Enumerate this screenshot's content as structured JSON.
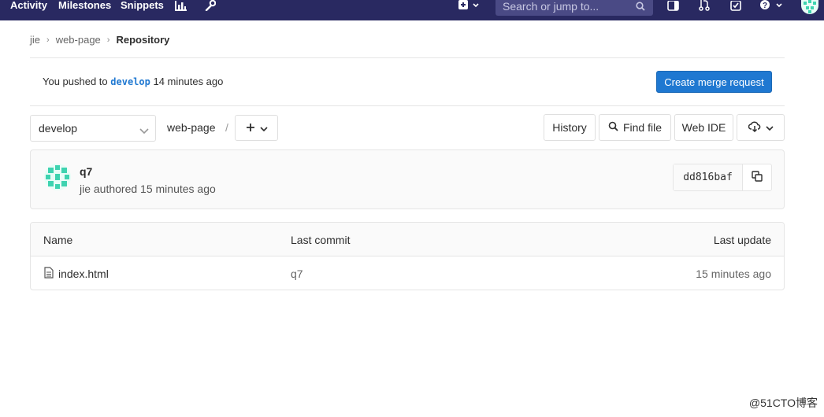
{
  "topbar": {
    "nav": [
      "Activity",
      "Milestones",
      "Snippets"
    ],
    "search_placeholder": "Search or jump to...",
    "icons": [
      "chart-icon",
      "wrench-icon",
      "plus-square-icon",
      "sidebar-icon",
      "merge-request-icon",
      "todo-icon",
      "help-icon",
      "user-avatar"
    ]
  },
  "breadcrumb": {
    "items": [
      "jie",
      "web-page"
    ],
    "current": "Repository"
  },
  "push_banner": {
    "prefix": "You pushed to",
    "branch": "develop",
    "suffix": "14 minutes ago",
    "button": "Create merge request"
  },
  "toolbar": {
    "branch": "develop",
    "path_root": "web-page",
    "path_sep": "/",
    "history": "History",
    "find_file": "Find file",
    "web_ide": "Web IDE"
  },
  "commit": {
    "title": "q7",
    "meta": "jie authored 15 minutes ago",
    "sha": "dd816baf"
  },
  "table": {
    "headers": {
      "name": "Name",
      "last_commit": "Last commit",
      "last_update": "Last update"
    },
    "rows": [
      {
        "name": "index.html",
        "commit": "q7",
        "updated": "15 minutes ago"
      }
    ]
  },
  "watermark": "@51CTO博客",
  "colors": {
    "topbar": "#292961",
    "primary": "#1f78d1"
  }
}
